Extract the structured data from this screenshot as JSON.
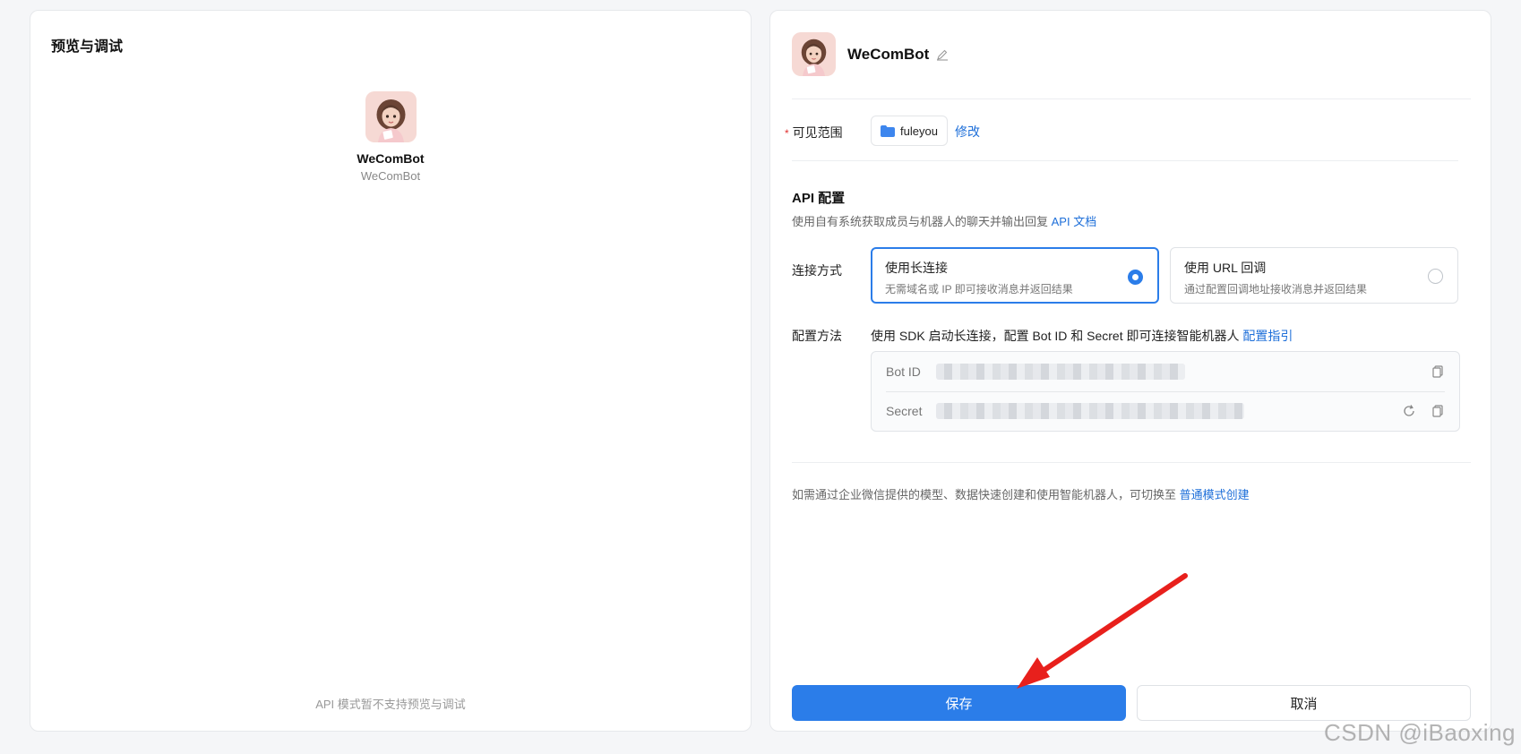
{
  "preview": {
    "title": "预览与调试",
    "bot_name": "WeComBot",
    "bot_sub": "WeComBot",
    "footer_note": "API 模式暂不支持预览与调试"
  },
  "config": {
    "bot_name": "WeComBot",
    "scope": {
      "label": "可见范围",
      "value": "fuleyou",
      "modify": "修改"
    },
    "api": {
      "title": "API 配置",
      "desc": "使用自有系统获取成员与机器人的聊天并输出回复",
      "doc_link": "API 文档"
    },
    "connection": {
      "label": "连接方式",
      "options": [
        {
          "title": "使用长连接",
          "desc": "无需域名或 IP 即可接收消息并返回结果",
          "selected": true
        },
        {
          "title": "使用 URL 回调",
          "desc": "通过配置回调地址接收消息并返回结果",
          "selected": false
        }
      ]
    },
    "method": {
      "label": "配置方法",
      "text": "使用 SDK 启动长连接，配置 Bot ID 和 Secret 即可连接智能机器人",
      "guide_link": "配置指引",
      "bot_id_label": "Bot ID",
      "secret_label": "Secret"
    },
    "hint": {
      "text": "如需通过企业微信提供的模型、数据快速创建和使用智能机器人，可切换至",
      "link": "普通模式创建"
    },
    "save_label": "保存",
    "cancel_label": "取消"
  },
  "watermark": "CSDN @iBaoxing",
  "colors": {
    "accent": "#2b7de9",
    "link": "#1e6fd9",
    "annotation_arrow": "#e8201c"
  }
}
